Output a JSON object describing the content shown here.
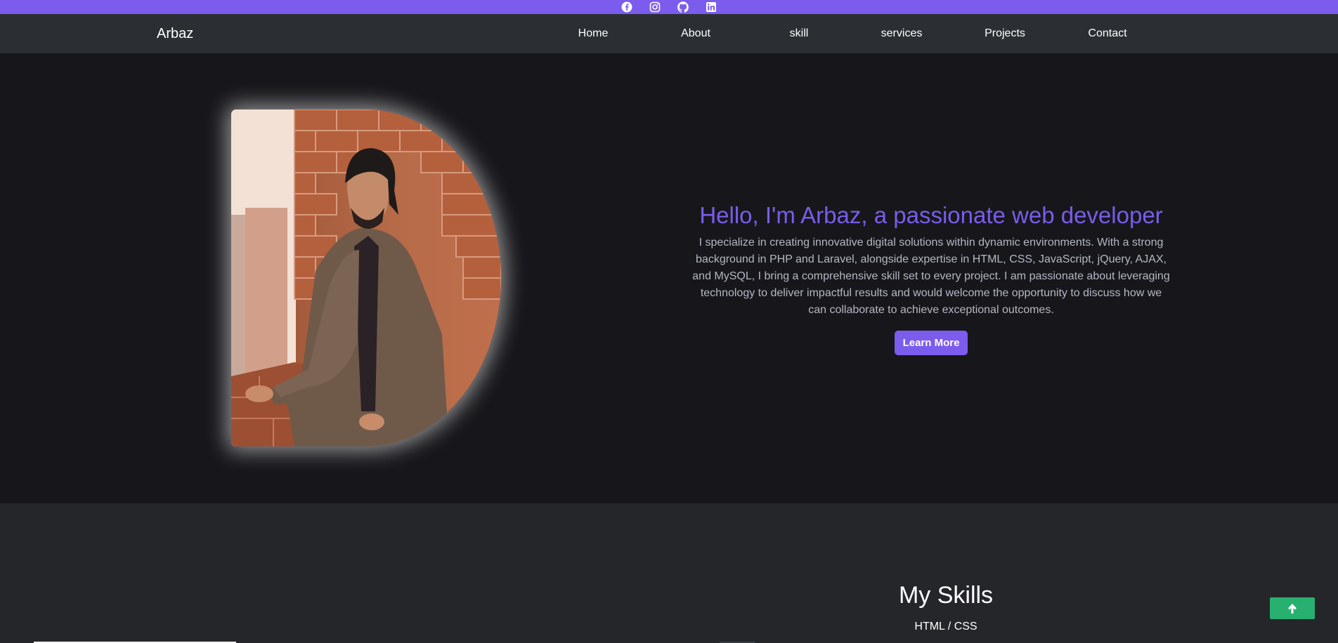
{
  "social": {
    "icons": [
      "facebook-icon",
      "instagram-icon",
      "github-icon",
      "linkedin-icon"
    ],
    "bar_color": "#7b5cec"
  },
  "nav": {
    "brand": "Arbaz",
    "links": [
      "Home",
      "About",
      "skill",
      "services",
      "Projects",
      "Contact"
    ]
  },
  "hero": {
    "title": "Hello, I'm Arbaz, a passionate web developer",
    "description": "I specialize in creating innovative digital solutions within dynamic environments. With a strong background in PHP and Laravel, alongside expertise in HTML, CSS, JavaScript, jQuery, AJAX, and MySQL, I bring a comprehensive skill set to every project. I am passionate about leveraging technology to deliver impactful results and would welcome the opportunity to discuss how we can collaborate to achieve exceptional outcomes.",
    "button_label": "Learn More",
    "accent": "#7b5cec"
  },
  "skills": {
    "title": "My Skills",
    "first_skill": "HTML / CSS"
  },
  "back_to_top": {
    "icon": "arrow-up-icon",
    "color": "#28b070"
  }
}
